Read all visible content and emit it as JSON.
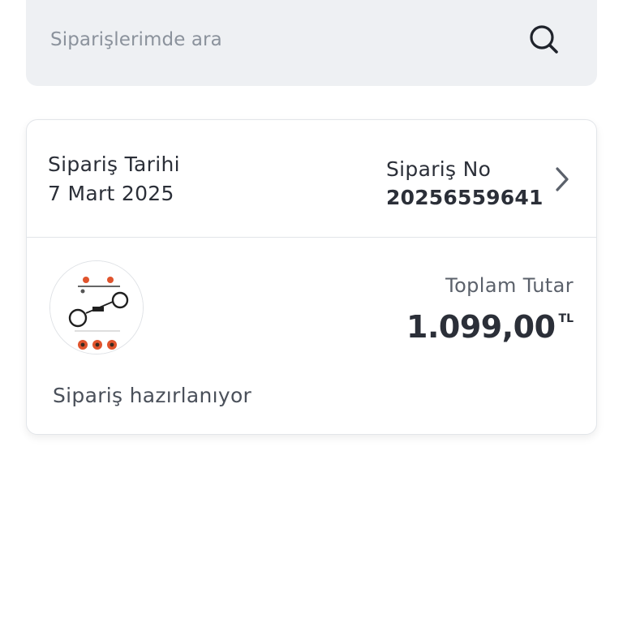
{
  "search": {
    "placeholder": "Siparişlerimde ara",
    "value": ""
  },
  "order": {
    "date_label": "Sipariş Tarihi",
    "date_value": "7 Mart 2025",
    "number_label": "Sipariş No",
    "number_value": "20256559641",
    "total_label": "Toplam Tutar",
    "total_amount": "1.099,00",
    "currency": "TL",
    "status": "Sipariş hazırlanıyor",
    "product_image_icon": "product-thumbnail-icon"
  },
  "icons": {
    "search": "search-icon",
    "chevron": "chevron-right-icon"
  },
  "colors": {
    "search_bg": "#eef0f3",
    "text": "#2b2f38",
    "muted": "#8b929c",
    "border": "#e2e5e9",
    "product_accent": "#e0542d"
  }
}
